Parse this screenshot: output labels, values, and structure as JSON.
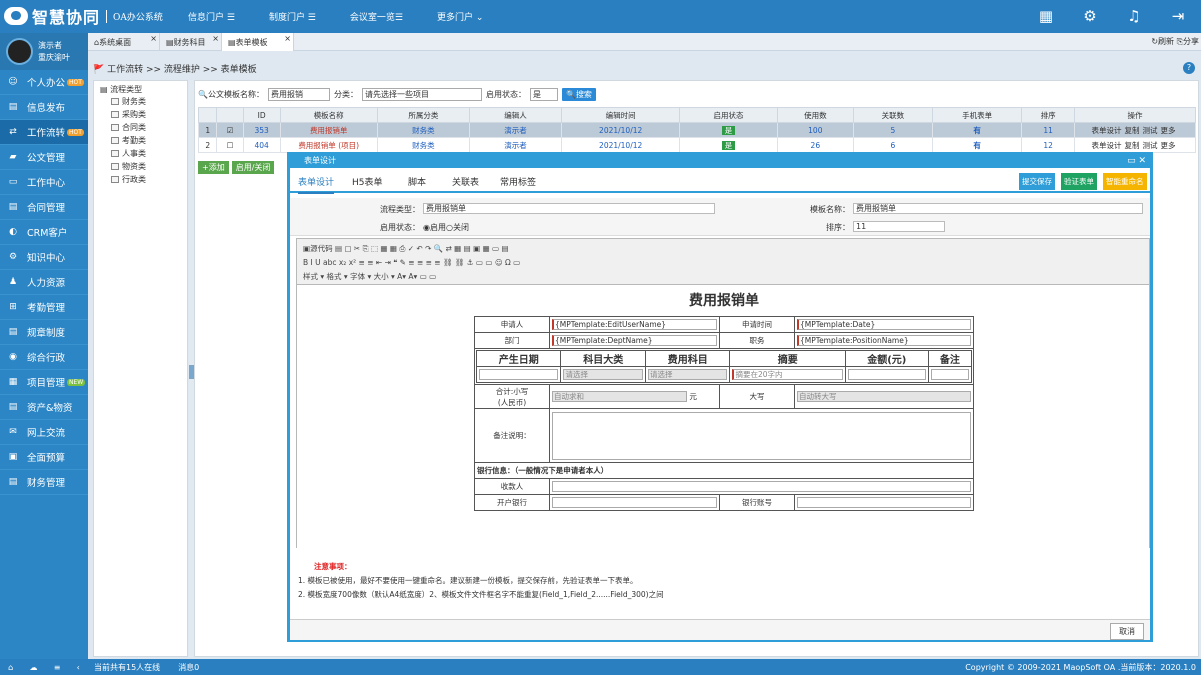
{
  "app": {
    "logo": "智慧协同",
    "logo_sub": "OA办公系统"
  },
  "topnav": [
    "信息门户 ☰",
    "制度门户 ☰",
    "会议室一览☰",
    "更多门户 ⌄"
  ],
  "user": {
    "name": "演示者",
    "dept": "重庆渝叶"
  },
  "sidebar": [
    {
      "label": "个人办公",
      "badge": "HOT",
      "icon": "person-icon"
    },
    {
      "label": "信息发布",
      "icon": "doc-icon"
    },
    {
      "label": "工作流转",
      "badge": "HOT",
      "icon": "flow-icon",
      "active": true
    },
    {
      "label": "公文管理",
      "icon": "folder-icon"
    },
    {
      "label": "工作中心",
      "icon": "monitor-icon"
    },
    {
      "label": "合同管理",
      "icon": "contract-icon"
    },
    {
      "label": "CRM客户",
      "icon": "crm-icon"
    },
    {
      "label": "知识中心",
      "icon": "knowledge-icon"
    },
    {
      "label": "人力资源",
      "icon": "hr-icon"
    },
    {
      "label": "考勤管理",
      "icon": "attendance-icon"
    },
    {
      "label": "规章制度",
      "icon": "rules-icon"
    },
    {
      "label": "综合行政",
      "icon": "admin-icon"
    },
    {
      "label": "项目管理",
      "badge": "NEW",
      "icon": "project-icon"
    },
    {
      "label": "资产&物资",
      "icon": "asset-icon"
    },
    {
      "label": "网上交流",
      "icon": "chat-icon"
    },
    {
      "label": "全面预算",
      "icon": "budget-icon"
    },
    {
      "label": "财务管理",
      "icon": "finance-icon"
    }
  ],
  "tabs": [
    "系统桌面",
    "财务科目",
    "表单模板"
  ],
  "tab_right": "↻刷新 ⎘分享",
  "breadcrumb": "工作流转 >> 流程维护 >> 表单模板",
  "tree": {
    "root": "流程类型",
    "items": [
      "财务类",
      "采购类",
      "合同类",
      "考勤类",
      "人事类",
      "物资类",
      "行政类"
    ]
  },
  "search": {
    "name_label": "公文模板名称：",
    "name_value": "费用报销",
    "cat_label": "分类：",
    "cat_value": "请先选择一些项目",
    "status_label": "启用状态：",
    "status_value": "是",
    "btn": "搜索"
  },
  "grid": {
    "headers": [
      "",
      "ID",
      "模板名称",
      "所属分类",
      "编辑人",
      "编辑时间",
      "启用状态",
      "使用数",
      "关联数",
      "手机表单",
      "排序",
      "操作"
    ],
    "rows": [
      {
        "no": "1",
        "id": "353",
        "name": "费用报销单",
        "cat": "财务类",
        "editor": "演示者",
        "time": "2021/10/12",
        "status": "是",
        "used": "100",
        "rel": "5",
        "mobile": "有",
        "sort": "11",
        "ops": [
          "表单设计",
          "复制",
          "测试",
          "更多"
        ]
      },
      {
        "no": "2",
        "id": "404",
        "name": "费用报销单 (项目)",
        "cat": "财务类",
        "editor": "演示者",
        "time": "2021/10/12",
        "status": "是",
        "used": "26",
        "rel": "6",
        "mobile": "有",
        "sort": "12",
        "ops": [
          "表单设计",
          "复制",
          "测试",
          "更多"
        ]
      }
    ]
  },
  "add_bar": [
    "+添加",
    "启用/关闭"
  ],
  "modal": {
    "title": "表单设计",
    "tabs": [
      "表单设计",
      "H5表单",
      "脚本",
      "关联表",
      "常用标签"
    ],
    "buttons": [
      "提交保存",
      "验证表单",
      "智能重命名"
    ],
    "flow_type_label": "流程类型：",
    "flow_type_value": "费用报销单",
    "status_label": "启用状态：",
    "status_on": "启用",
    "status_off": "关闭",
    "tpl_name_label": "模板名称：",
    "tpl_name_value": "费用报销单",
    "sort_label": "排序：",
    "sort_value": "11",
    "toolbar_row1": "▣源代码 ▤ ▢ ✂ ⎘ ⬚ ▦ ▦ ⎙ ✓ ↶ ↷ 🔍 ⇄ ▦ ▤ ▣ ▦ ▭ ▤",
    "toolbar_row2": "B I U abc x₂ x² ≡ ≡ ⇤ ⇥ ❝ ✎ ≡ ≡ ≡ ≡ ⛓ ⛓ ⚓ ▭ ▭ ☺ Ω ▭",
    "toolbar_row3": "样式 ▾ 格式 ▾ 字体 ▾ 大小 ▾ A▾ A▾ ▭ ▭",
    "doc": {
      "title": "费用报销单",
      "applicant": "申请人",
      "applicant_v": "{MPTemplate:EditUserName}",
      "apply_time": "申请时间",
      "apply_time_v": "{MPTemplate:Date}",
      "dept": "部门",
      "dept_v": "{MPTemplate:DeptName}",
      "position": "职务",
      "position_v": "{MPTemplate:PositionName}",
      "cols": [
        "产生日期",
        "科目大类",
        "费用科目",
        "摘要",
        "金额(元)",
        "备注"
      ],
      "sel": "请选择",
      "summary_ph": "摘要在20字内",
      "total_l": "合计:小写\n(人民币)",
      "auto_sum": "自动求和",
      "yuan": "元",
      "upper": "大写",
      "auto_upper": "自动转大写",
      "remark": "备注说明：",
      "bank_info": "银行信息：（一般情况下是申请者本人）",
      "payee": "收款人",
      "bank": "开户银行",
      "account": "银行账号"
    },
    "notes_title": "注意事项：",
    "notes": [
      "1.     模板已被使用，最好不要使用一键重命名。建议新建一份模板，提交保存前，先验证表单一下表单。",
      "2.     模板宽度700像数（默认A4纸宽度）2、模板文件文件框名字不能重复(Field_1,Field_2......Field_300)之间"
    ],
    "cancel": "取消"
  },
  "status": {
    "online": "当前共有15人在线",
    "msg": "消息0",
    "copyright": "Copyright © 2009-2021 MaopSoft OA .当前版本：2020.1.0"
  }
}
